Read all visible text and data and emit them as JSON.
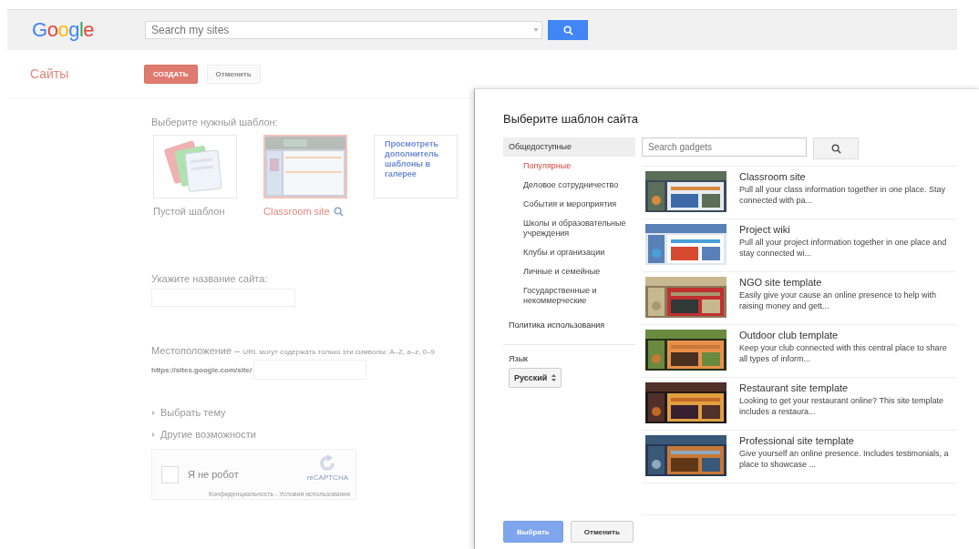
{
  "header": {
    "logo": "Google",
    "search": {
      "placeholder": "Search my sites"
    }
  },
  "toolbar": {
    "title": "Сайты",
    "buttons": [
      {
        "label": "СОЗДАТЬ",
        "kind": "primary"
      },
      {
        "label": "Отменить",
        "kind": "secondary"
      }
    ]
  },
  "form": {
    "template_prompt": "Выберите нужный шаблон:",
    "templates": [
      {
        "kind": "blank",
        "caption": "Пустой шаблон",
        "selected": false
      },
      {
        "kind": "template",
        "caption": "Classroom site",
        "selected": true
      },
      {
        "kind": "gallery",
        "link": "Просмотреть дополнитель шаблоны в галерее",
        "selected": false
      }
    ],
    "name_label": "Укажите название сайта:",
    "location_label": "Местоположение –",
    "location_hint": "URL могут содержать только эти символы: A–Z, a–z, 0–9",
    "url_prefix": "https://sites.google.com/site/",
    "expanders": [
      {
        "label": "Выбрать тему",
        "expanded": false
      },
      {
        "label": "Другие возможности",
        "expanded": false
      }
    ],
    "captcha": {
      "label": "Я не робот",
      "checked": false,
      "brand": "reCAPTCHA",
      "footer": "Конфиденциальность - Условия использования"
    }
  },
  "dialog": {
    "title": "Выберите шаблон сайта",
    "nav": [
      {
        "label": "Общедоступные",
        "selected": true,
        "children": [
          {
            "label": "Популярные",
            "selected": true
          },
          {
            "label": "Деловое сотрудничество",
            "selected": false
          },
          {
            "label": "События и мероприятия",
            "selected": false
          },
          {
            "label": "Школы и образовательные учреждения",
            "selected": false
          },
          {
            "label": "Клубы и организации",
            "selected": false
          },
          {
            "label": "Личные и семейные",
            "selected": false
          },
          {
            "label": "Государственные и некоммерческие",
            "selected": false
          }
        ]
      },
      {
        "label": "Политика использования",
        "selected": false
      }
    ],
    "language": {
      "label": "Язык",
      "value": "Русский"
    },
    "search": {
      "placeholder": "Search gadgets"
    },
    "templates": [
      {
        "title": "Classroom site",
        "description": "Pull all your class information together in one place. Stay connected with pa..."
      },
      {
        "title": "Project wiki",
        "description": "Pull all your project information together in one place and stay connected wi..."
      },
      {
        "title": "NGO site template",
        "description": "Easily give your cause an online presence to help with raising money and gett..."
      },
      {
        "title": "Outdoor club template",
        "description": "Keep your club connected with this central place to share all types of inform..."
      },
      {
        "title": "Restaurant site template",
        "description": "Looking to get your restaurant online? This site template includes a restaura..."
      },
      {
        "title": "Professional site template",
        "description": "Give yourself an online presence. Includes testimonials, a place to showcase ..."
      }
    ],
    "buttons": [
      {
        "label": "Выбрать",
        "kind": "primary",
        "disabled": true
      },
      {
        "label": "Отменить",
        "kind": "secondary",
        "disabled": false
      }
    ]
  }
}
